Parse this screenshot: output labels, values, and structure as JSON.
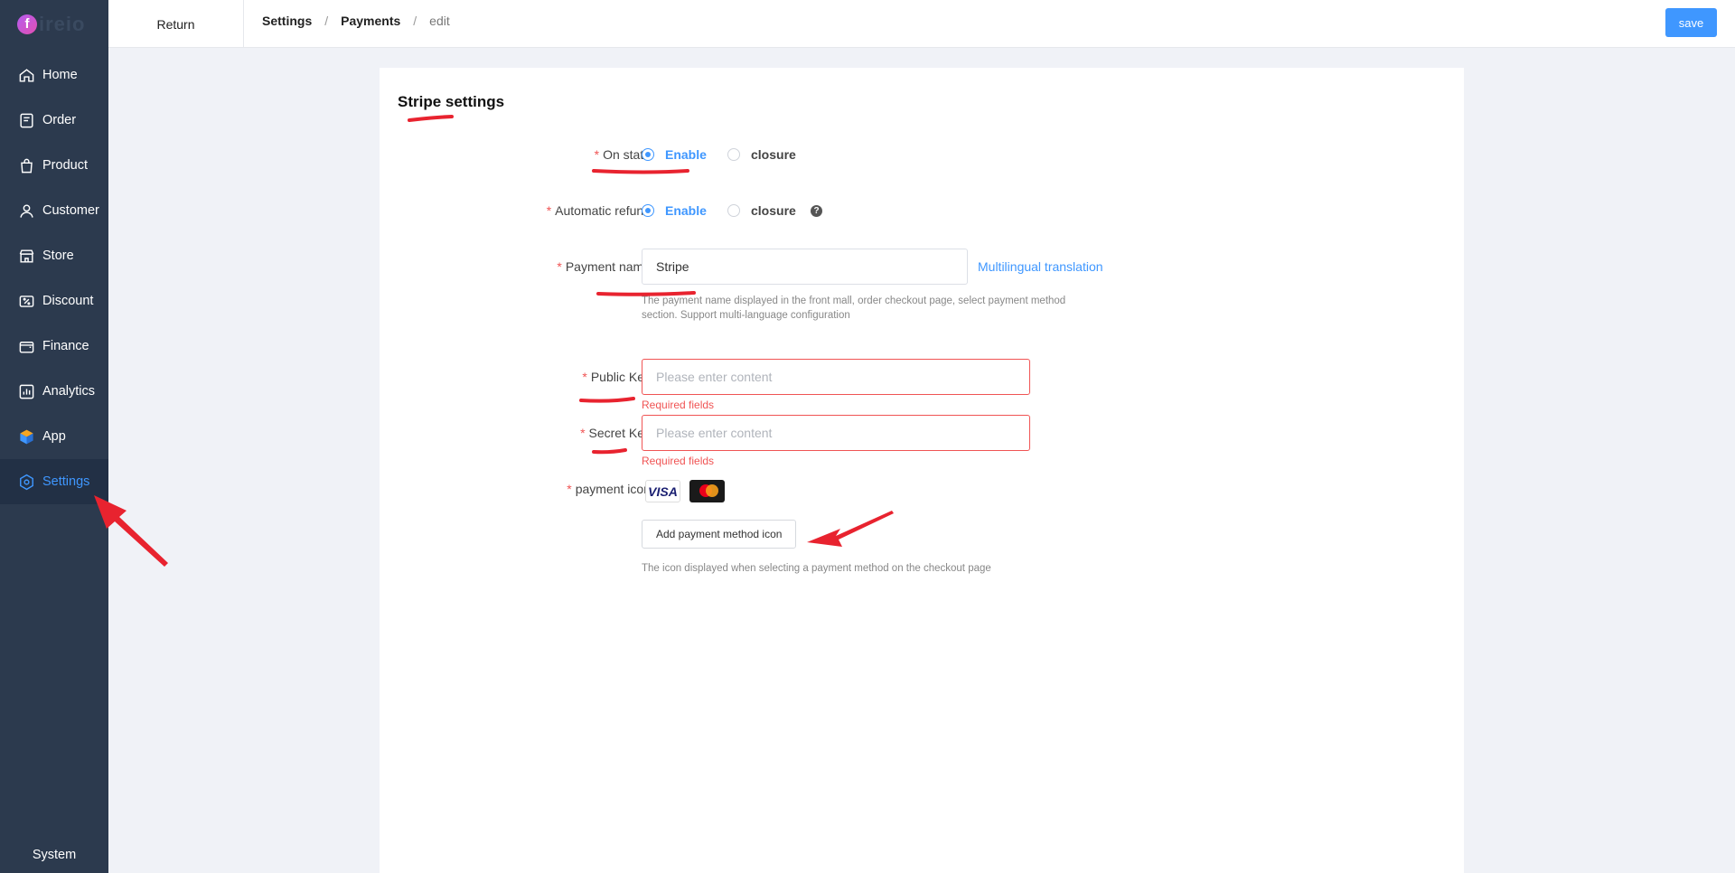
{
  "brand": {
    "name": "Fireio",
    "mark": "f"
  },
  "sidebar": {
    "items": [
      {
        "label": "Home",
        "icon": "home-icon"
      },
      {
        "label": "Order",
        "icon": "order-icon"
      },
      {
        "label": "Product",
        "icon": "bag-icon"
      },
      {
        "label": "Customer",
        "icon": "user-icon"
      },
      {
        "label": "Store",
        "icon": "store-icon"
      },
      {
        "label": "Discount",
        "icon": "discount-icon"
      },
      {
        "label": "Finance",
        "icon": "wallet-icon"
      },
      {
        "label": "Analytics",
        "icon": "chart-icon"
      },
      {
        "label": "App",
        "icon": "app-cube-icon"
      },
      {
        "label": "Settings",
        "icon": "gear-icon",
        "active": true
      }
    ],
    "footer": "System"
  },
  "header": {
    "return_label": "Return",
    "breadcrumb": [
      "Settings",
      "Payments",
      "edit"
    ],
    "breadcrumb_sep": "/",
    "save_label": "save"
  },
  "form": {
    "title": "Stripe settings",
    "on_state": {
      "label": "On state",
      "options": [
        "Enable",
        "closure"
      ],
      "selected": "Enable"
    },
    "auto_refund": {
      "label": "Automatic refund",
      "options": [
        "Enable",
        "closure"
      ],
      "selected": "Enable",
      "help": "?"
    },
    "payment_name": {
      "label": "Payment name",
      "value": "Stripe",
      "link": "Multilingual translation",
      "hint": "The payment name displayed in the front mall, order checkout page, select payment method section. Support multi-language configuration"
    },
    "public_key": {
      "label": "Public Key",
      "placeholder": "Please enter content",
      "error": "Required fields"
    },
    "secret_key": {
      "label": "Secret Key",
      "placeholder": "Please enter content",
      "error": "Required fields"
    },
    "payment_icon": {
      "label": "payment icon",
      "icons": [
        "VISA",
        "mastercard"
      ],
      "add_label": "Add payment method icon",
      "hint": "The icon displayed when selecting a payment method on the checkout page"
    },
    "required_mark": "*"
  },
  "colors": {
    "accent": "#3f97ff",
    "sidebar": "#2c3a4e",
    "error": "#f05454",
    "annotation": "#e8232f"
  }
}
